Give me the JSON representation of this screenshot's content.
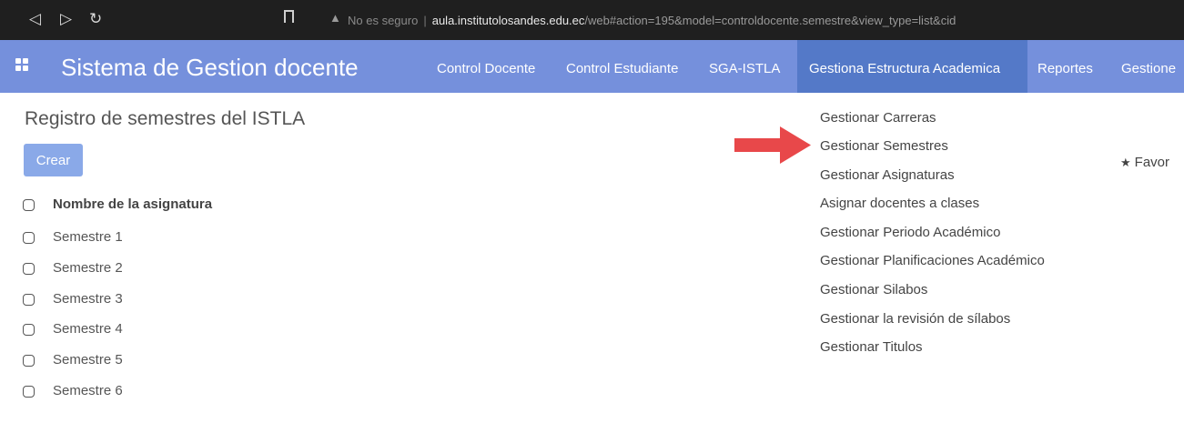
{
  "browser": {
    "url_warning": "No es seguro",
    "url_separator": "|",
    "url_domain": "aula.institutolosandes.edu.ec",
    "url_path": "/web#action=195&model=controldocente.semestre&view_type=list&cid"
  },
  "appbar": {
    "brand": "Sistema de Gestion docente",
    "menu": [
      {
        "label": "Control Docente"
      },
      {
        "label": "Control Estudiante"
      },
      {
        "label": "SGA-ISTLA"
      },
      {
        "label": "Gestiona Estructura Academica",
        "active": true
      },
      {
        "label": "Reportes"
      },
      {
        "label": "Gestione"
      }
    ]
  },
  "main": {
    "title": "Registro de semestres del ISTLA",
    "create_label": "Crear",
    "favorites_label": "Favor",
    "list": {
      "header": "Nombre de la asignatura",
      "rows": [
        "Semestre 1",
        "Semestre 2",
        "Semestre 3",
        "Semestre 4",
        "Semestre 5",
        "Semestre 6"
      ]
    }
  },
  "dropdown": {
    "items": [
      "Gestionar Carreras",
      "Gestionar Semestres",
      "Gestionar Asignaturas",
      "Asignar docentes a clases",
      "Gestionar Periodo Académico",
      "Gestionar Planificaciones Académico",
      "Gestionar Silabos",
      "Gestionar la revisión de sílabos",
      "Gestionar Titulos"
    ]
  },
  "colors": {
    "appbar": "#7590dc",
    "active_menu": "#5479c8",
    "create_button": "#8aa9e8",
    "arrow": "#e8484a"
  },
  "icons": [
    "back-icon",
    "forward-icon",
    "reload-icon",
    "bookmark-icon",
    "warning-icon",
    "apps-grid-icon",
    "star-icon",
    "arrow-pointer-icon"
  ]
}
